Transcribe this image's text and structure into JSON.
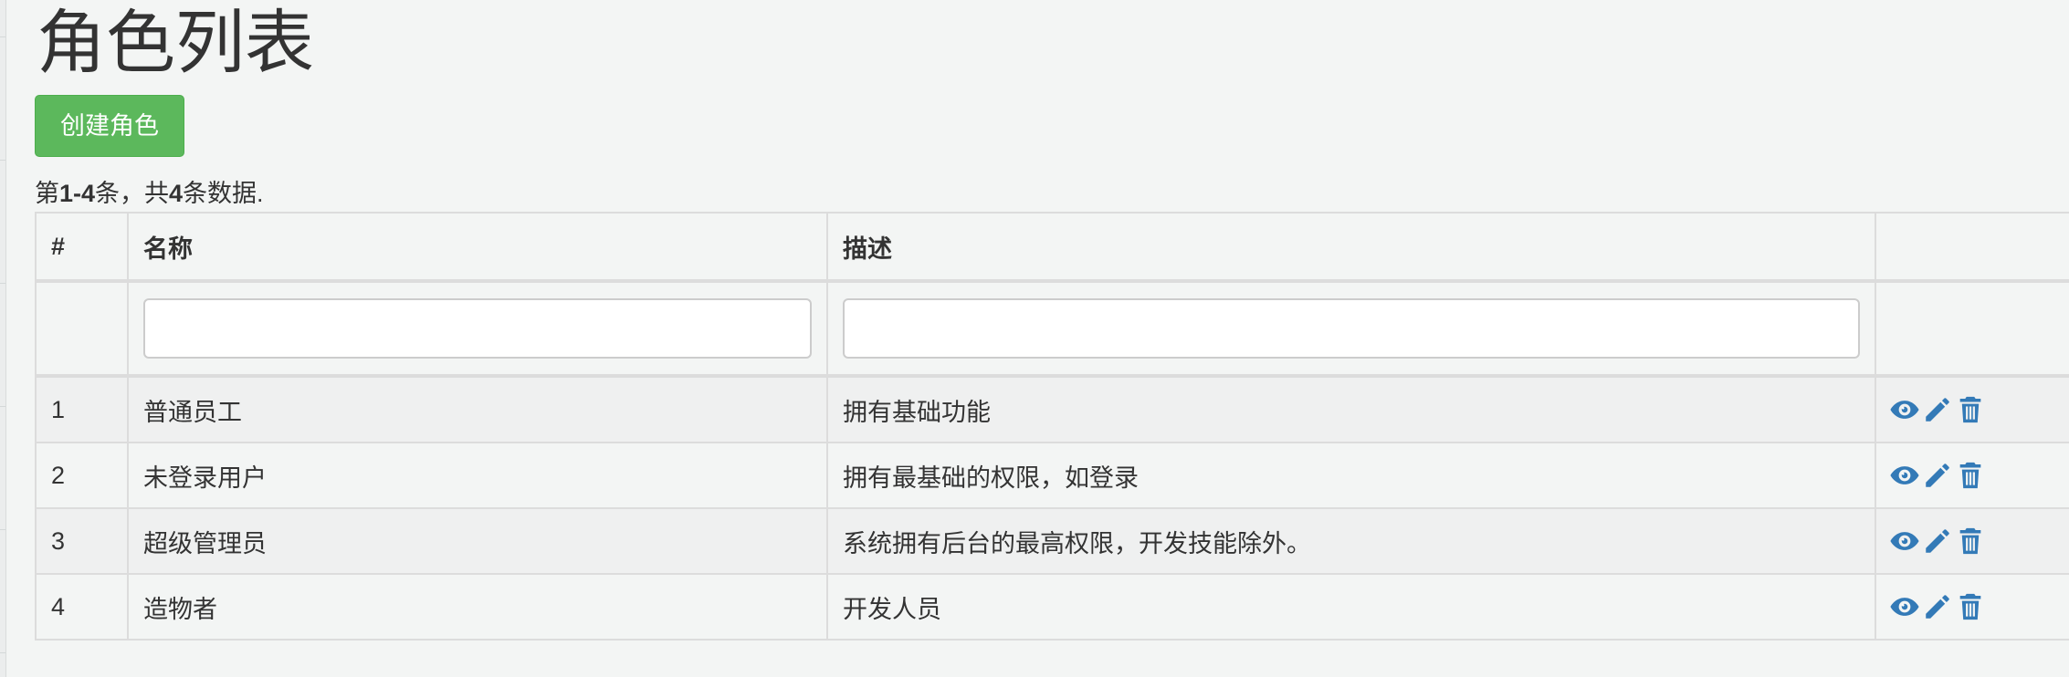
{
  "page": {
    "title": "角色列表",
    "create_label": "创建角色"
  },
  "summary": {
    "prefix": "第",
    "range": "1-4",
    "middle": "条，共",
    "total": "4",
    "suffix": "条数据."
  },
  "table": {
    "headers": [
      "#",
      "名称",
      "描述",
      ""
    ],
    "filters": {
      "name_value": "",
      "description_value": ""
    },
    "rows": [
      {
        "index": "1",
        "name": "普通员工",
        "description": "拥有基础功能"
      },
      {
        "index": "2",
        "name": "未登录用户",
        "description": "拥有最基础的权限，如登录"
      },
      {
        "index": "3",
        "name": "超级管理员",
        "description": "系统拥有后台的最高权限，开发技能除外。"
      },
      {
        "index": "4",
        "name": "造物者",
        "description": "开发人员"
      }
    ],
    "row_actions": [
      "eye-icon",
      "pencil-icon",
      "trash-icon"
    ]
  },
  "colors": {
    "primary_button": "#5cb85c",
    "action_icon": "#337ab7",
    "background": "#f3f5f4"
  }
}
